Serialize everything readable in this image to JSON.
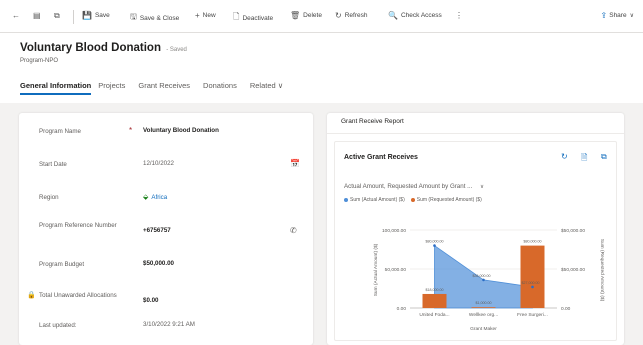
{
  "command_bar": {
    "items": [
      {
        "name": "back-button",
        "icon": "back-arrow-icon",
        "glyph": "←",
        "label": ""
      },
      {
        "name": "form-view-button",
        "icon": "form-icon",
        "glyph": "▤",
        "label": ""
      },
      {
        "name": "open-new-window-button",
        "icon": "open-window-icon",
        "glyph": "⧉",
        "label": ""
      },
      {
        "name": "save-button",
        "icon": "save-icon",
        "glyph": "💾",
        "label": "Save"
      },
      {
        "name": "save-close-button",
        "icon": "save-close-icon",
        "glyph": "🖫",
        "label": "Save & Close"
      },
      {
        "name": "new-button",
        "icon": "plus-icon",
        "glyph": "+",
        "label": "New"
      },
      {
        "name": "deactivate-button",
        "icon": "deactivate-icon",
        "glyph": "🗋",
        "label": "Deactivate"
      },
      {
        "name": "delete-button",
        "icon": "trash-icon",
        "glyph": "🗑",
        "label": "Delete"
      },
      {
        "name": "refresh-button",
        "icon": "refresh-icon",
        "glyph": "↻",
        "label": "Refresh"
      },
      {
        "name": "check-access-button",
        "icon": "check-access-icon",
        "glyph": "🔍",
        "label": "Check Access"
      },
      {
        "name": "more-commands-button",
        "icon": "more-vertical-icon",
        "glyph": "⋮",
        "label": ""
      }
    ],
    "share_label": "Share",
    "share_chevron": "∨"
  },
  "header": {
    "title": "Voluntary Blood Donation",
    "saved_status": "- Saved",
    "entity": "Program-NPO"
  },
  "tabs": [
    {
      "label": "General Information",
      "active": true
    },
    {
      "label": "Projects",
      "active": false
    },
    {
      "label": "Grant Receives",
      "active": false
    },
    {
      "label": "Donations",
      "active": false
    },
    {
      "label": "Related ∨",
      "active": false
    }
  ],
  "form": {
    "fields": [
      {
        "name": "program-name",
        "label": "Program Name",
        "required": "*",
        "value": "Voluntary Blood Donation",
        "style": "bold"
      },
      {
        "name": "start-date",
        "label": "Start Date",
        "value": "12/10/2022",
        "style": "muted",
        "icon": "calendar-icon",
        "icon_glyph": "📅"
      },
      {
        "name": "region",
        "label": "Region",
        "value": "Africa",
        "style": "link",
        "prefix_icon": "location-icon",
        "prefix_glyph": "⬙"
      },
      {
        "name": "program-reference-number",
        "label": "Program Reference Number",
        "value": "+6756757",
        "style": "bold",
        "icon": "phone-icon",
        "icon_glyph": "✆"
      },
      {
        "name": "program-budget",
        "label": "Program Budget",
        "value": "$50,000.00",
        "style": "bold"
      },
      {
        "name": "total-unawarded-allocations",
        "label": "Total Unawarded Allocations",
        "value": "$0.00",
        "style": "bold",
        "lock_icon": "lock-icon",
        "lock_glyph": "🔒"
      },
      {
        "name": "last-updated",
        "label": "Last updated:",
        "value": "3/10/2022 9:21 AM",
        "style": "muted"
      }
    ]
  },
  "report": {
    "section_title": "Grant Receive Report",
    "view_title": "Active Grant Receives",
    "view_icons": [
      {
        "name": "refresh-icon",
        "glyph": "↻"
      },
      {
        "name": "export-icon",
        "glyph": "🗎"
      },
      {
        "name": "expand-icon",
        "glyph": "⧉"
      }
    ],
    "chart_title": "Actual Amount, Requested Amount by Grant ...",
    "chart_title_chevron": "∨"
  },
  "chart_data": {
    "type": "bar",
    "categories": [
      "United Foda...",
      "Wellkee org...",
      "Free Surgeri..."
    ],
    "xlabel": "Grant Maker",
    "ylabel_left": "Sum (Actual Amount) ($)",
    "ylabel_right": "Sum (Requested Amount) ($)",
    "ylim": [
      0,
      100000
    ],
    "left_ticks": [
      "100,000.00",
      "50,000.00",
      "0.00"
    ],
    "right_ticks": [
      "$50,000.00",
      "$50,000.00",
      "0.00"
    ],
    "series": [
      {
        "name": "Sum (Actual Amount) ($)",
        "kind": "area",
        "color": "#4f8fd8",
        "values": [
          80000,
          36000,
          27000
        ],
        "labels": [
          "$80,000.00",
          "$36,000.00",
          "$27,000.00"
        ]
      },
      {
        "name": "Sum (Requested Amount) ($)",
        "kind": "bar",
        "color": "#d8692a",
        "values": [
          18000,
          1000,
          80000
        ],
        "labels": [
          "$18,000.00",
          "$1,000.00",
          "$80,000.00"
        ]
      }
    ],
    "legend_position": "top-left",
    "grid": true
  }
}
